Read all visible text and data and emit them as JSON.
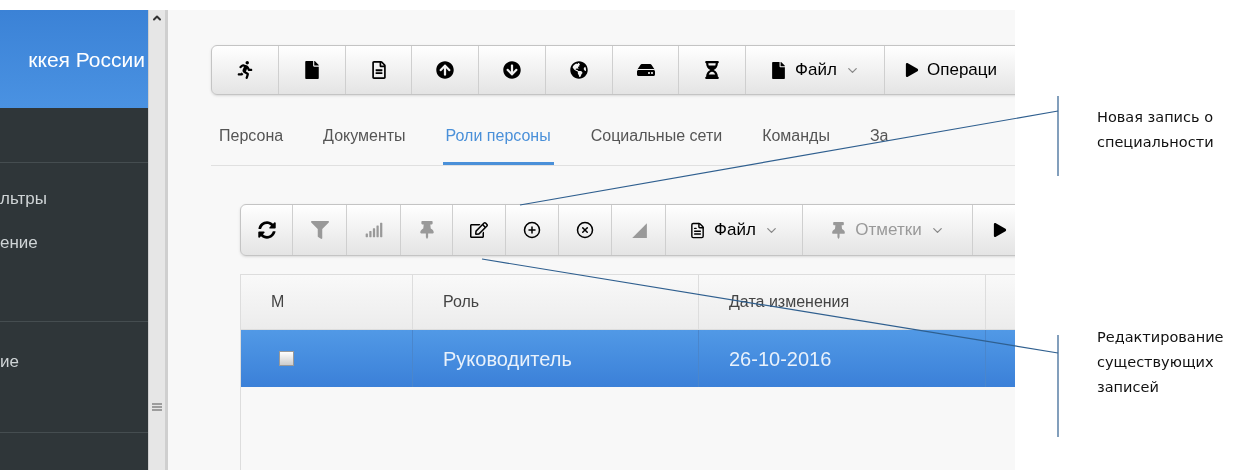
{
  "sidebar": {
    "header": "ккея России",
    "items": [
      {
        "label": "льтры"
      },
      {
        "label": "ение"
      },
      {
        "label": "ие"
      }
    ]
  },
  "main_toolbar": [
    {
      "kind": "icon",
      "disabled": false
    },
    {
      "kind": "icon",
      "disabled": false
    },
    {
      "kind": "icon",
      "disabled": false
    },
    {
      "kind": "icon",
      "disabled": false
    },
    {
      "kind": "icon",
      "disabled": false
    },
    {
      "kind": "icon",
      "disabled": false
    },
    {
      "kind": "icon",
      "disabled": false
    },
    {
      "kind": "icon",
      "disabled": false
    },
    {
      "kind": "dropdown",
      "label": "Файл",
      "disabled": false
    },
    {
      "kind": "play",
      "label": "Операци",
      "disabled": false
    }
  ],
  "tabs": [
    {
      "label": "Персона",
      "selected": false
    },
    {
      "label": "Документы",
      "selected": false
    },
    {
      "label": "Роли персоны",
      "selected": true
    },
    {
      "label": "Социальные сети",
      "selected": false
    },
    {
      "label": "Команды",
      "selected": false
    },
    {
      "label": "За",
      "selected": false
    }
  ],
  "grid_toolbar": [
    {
      "kind": "icon",
      "disabled": false
    },
    {
      "kind": "icon",
      "disabled": true
    },
    {
      "kind": "icon",
      "disabled": true
    },
    {
      "kind": "icon",
      "disabled": true
    },
    {
      "kind": "icon",
      "disabled": false
    },
    {
      "kind": "icon",
      "disabled": false
    },
    {
      "kind": "icon",
      "disabled": false
    },
    {
      "kind": "icon",
      "disabled": true
    },
    {
      "kind": "dropdown",
      "label": "Файл",
      "disabled": false
    },
    {
      "kind": "dropdown",
      "label": "Отметки",
      "disabled": true
    },
    {
      "kind": "play",
      "disabled": false
    }
  ],
  "table": {
    "columns": [
      "М",
      "Роль",
      "Дата изменения"
    ],
    "rows": [
      {
        "checked": false,
        "selected": true,
        "cells": [
          "",
          "Руководитель",
          "26-10-2016"
        ]
      }
    ]
  },
  "annotations": [
    {
      "text": "Новая запись о специальности"
    },
    {
      "text": "Редактирование существующих записей"
    }
  ]
}
